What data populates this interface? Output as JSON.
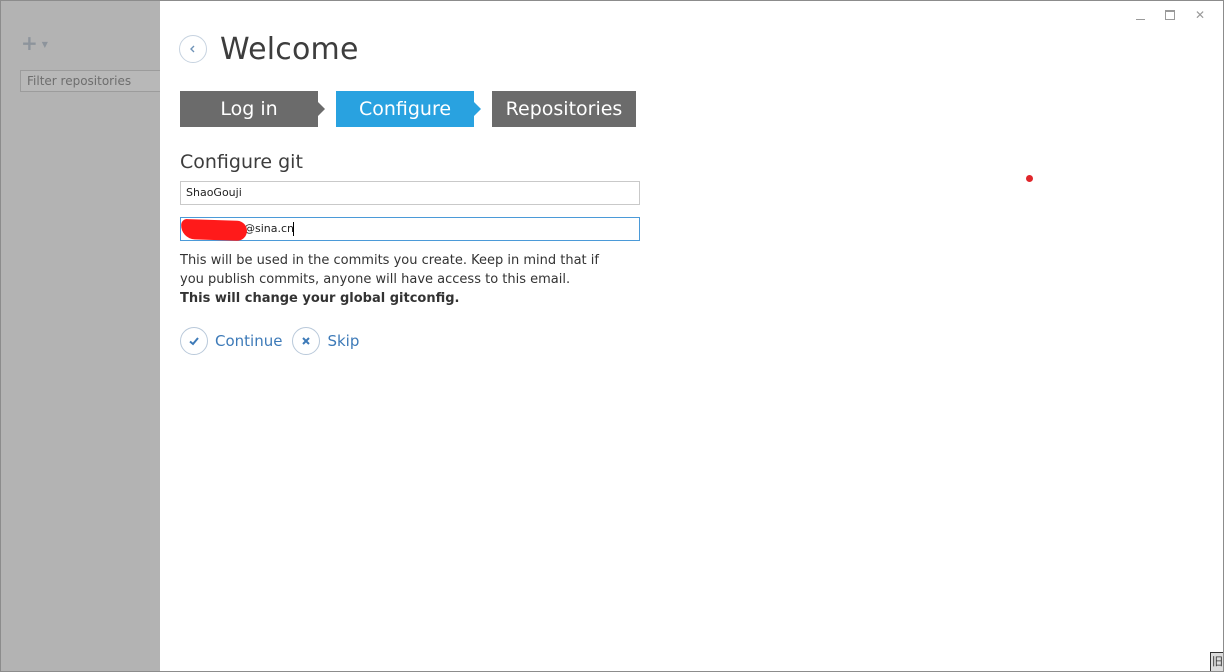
{
  "sidebar": {
    "add_icon": "plus-icon",
    "filter_placeholder": "Filter repositories"
  },
  "window": {
    "controls": [
      "minimize-icon",
      "maximize-icon",
      "close-icon"
    ],
    "close_glyph": "✕"
  },
  "header": {
    "title": "Welcome",
    "back_icon": "chevron-left-icon"
  },
  "steps": [
    {
      "label": "Log in",
      "state": "done"
    },
    {
      "label": "Configure",
      "state": "active"
    },
    {
      "label": "Repositories",
      "state": "pending"
    }
  ],
  "configure": {
    "section_title": "Configure git",
    "name_value": "ShaoGouji",
    "email_value": "@sina.cn",
    "help_text": "This will be used in the commits you create. Keep in mind that if you publish commits, anyone will have access to this email.",
    "help_strong": "This will change your global gitconfig."
  },
  "actions": {
    "continue_label": "Continue",
    "skip_label": "Skip"
  },
  "colors": {
    "accent": "#29a2e0",
    "step_inactive": "#6b6b6b",
    "link": "#3d7ab8",
    "sidebar_overlay": "#b3b3b3"
  },
  "corner_glyph": "旧"
}
